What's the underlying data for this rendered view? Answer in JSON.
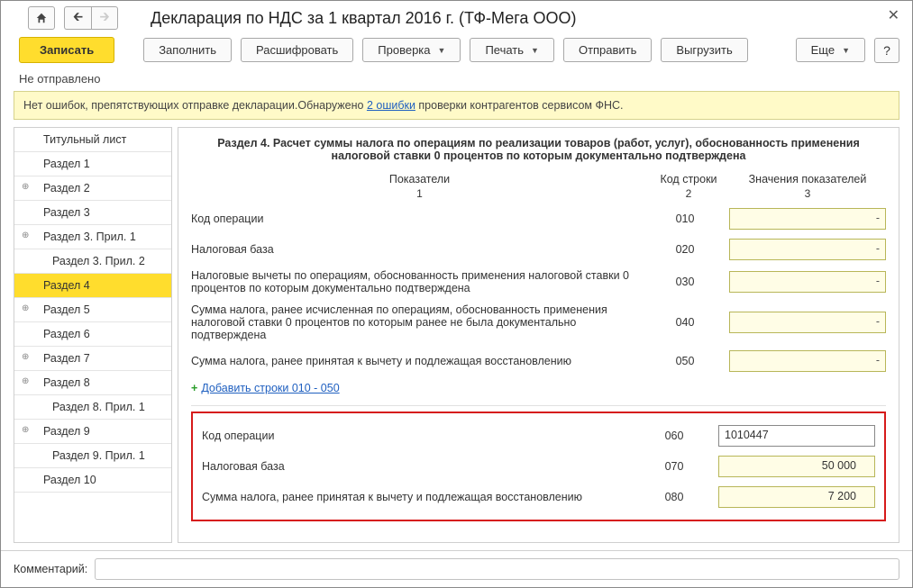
{
  "window": {
    "title": "Декларация по НДС за 1 квартал 2016 г. (ТФ-Мега ООО)"
  },
  "toolbar": {
    "save": "Записать",
    "fill": "Заполнить",
    "decode": "Расшифровать",
    "check": "Проверка",
    "print": "Печать",
    "send": "Отправить",
    "export": "Выгрузить",
    "more": "Еще",
    "help": "?"
  },
  "status": "Не отправлено",
  "banner": {
    "pre": "Нет ошибок, препятствующих отправке декларации.Обнаружено ",
    "link": "2 ошибки",
    "post": " проверки контрагентов сервисом ФНС."
  },
  "sidebar": [
    {
      "label": "Титульный лист",
      "expand": false,
      "indent": false,
      "active": false
    },
    {
      "label": "Раздел 1",
      "expand": false,
      "indent": false,
      "active": false
    },
    {
      "label": "Раздел 2",
      "expand": true,
      "indent": false,
      "active": false
    },
    {
      "label": "Раздел 3",
      "expand": false,
      "indent": false,
      "active": false
    },
    {
      "label": "Раздел 3. Прил. 1",
      "expand": true,
      "indent": false,
      "active": false
    },
    {
      "label": "Раздел 3. Прил. 2",
      "expand": false,
      "indent": true,
      "active": false
    },
    {
      "label": "Раздел 4",
      "expand": false,
      "indent": false,
      "active": true
    },
    {
      "label": "Раздел 5",
      "expand": true,
      "indent": false,
      "active": false
    },
    {
      "label": "Раздел 6",
      "expand": false,
      "indent": false,
      "active": false
    },
    {
      "label": "Раздел 7",
      "expand": true,
      "indent": false,
      "active": false
    },
    {
      "label": "Раздел 8",
      "expand": true,
      "indent": false,
      "active": false
    },
    {
      "label": "Раздел 8. Прил. 1",
      "expand": false,
      "indent": true,
      "active": false
    },
    {
      "label": "Раздел 9",
      "expand": true,
      "indent": false,
      "active": false
    },
    {
      "label": "Раздел 9. Прил. 1",
      "expand": false,
      "indent": true,
      "active": false
    },
    {
      "label": "Раздел 10",
      "expand": false,
      "indent": false,
      "active": false
    }
  ],
  "section": {
    "heading": "Раздел 4. Расчет суммы налога по операциям по реализации товаров (работ, услуг), обоснованность применения налоговой ставки 0 процентов по которым документально подтверждена",
    "columns": {
      "c1": "Показатели",
      "c1n": "1",
      "c2": "Код строки",
      "c2n": "2",
      "c3": "Значения показателей",
      "c3n": "3"
    },
    "rows1": [
      {
        "label": "Код операции",
        "code": "010",
        "value": "",
        "dash": true
      },
      {
        "label": "Налоговая база",
        "code": "020",
        "value": "",
        "dash": true
      },
      {
        "label": "Налоговые вычеты по операциям, обоснованность применения налоговой ставки 0 процентов по которым документально подтверждена",
        "code": "030",
        "value": "",
        "dash": true
      },
      {
        "label": "Сумма налога, ранее исчисленная по операциям, обоснованность применения налоговой ставки 0 процентов по которым ранее не была документально подтверждена",
        "code": "040",
        "value": "",
        "dash": true
      },
      {
        "label": "Сумма налога, ранее принятая к вычету и подлежащая восстановлению",
        "code": "050",
        "value": "",
        "dash": true
      }
    ],
    "add_link": "Добавить строки 010 - 050",
    "rows2": [
      {
        "label": "Код операции",
        "code": "060",
        "value": "1010447",
        "white": true
      },
      {
        "label": "Налоговая база",
        "code": "070",
        "value": "50 000",
        "white": false
      },
      {
        "label": "Сумма налога, ранее принятая к вычету и подлежащая восстановлению",
        "code": "080",
        "value": "7 200",
        "white": false
      }
    ]
  },
  "footer": {
    "label": "Комментарий:",
    "value": ""
  }
}
